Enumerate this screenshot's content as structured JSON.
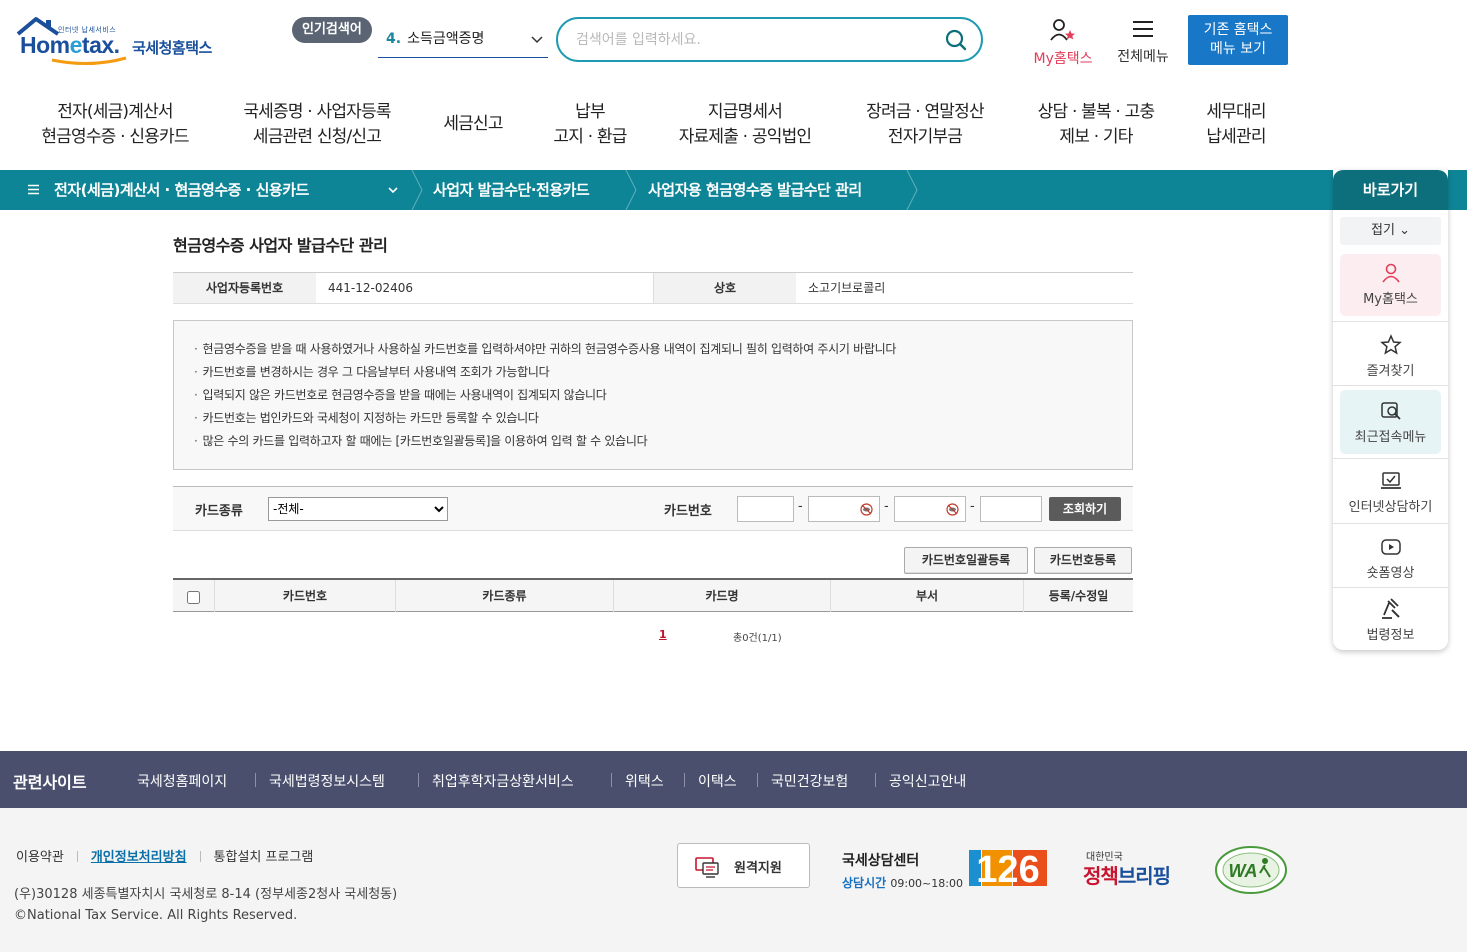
{
  "header": {
    "logo_tagline": "인터넷 납세서비스",
    "logo_word_a": "Hom",
    "logo_word_e": "e",
    "logo_word_b": "tax.",
    "logo_kr": "국세청홈택스",
    "popular_badge": "인기검색어",
    "popular_num": "4.",
    "popular_term": "소득금액증명",
    "search_placeholder": "검색어를 입력하세요.",
    "myhome_label": "My홈택스",
    "allmenu_label": "전체메뉴",
    "oldhome_line1": "기존 홈택스",
    "oldhome_line2": "메뉴 보기"
  },
  "gnb": [
    {
      "l1": "전자(세금)계산서",
      "l2": "현금영수증 · 신용카드"
    },
    {
      "l1": "국세증명 · 사업자등록",
      "l2": "세금관련 신청/신고"
    },
    {
      "l1": "세금신고",
      "l2": ""
    },
    {
      "l1": "납부",
      "l2": "고지 · 환급"
    },
    {
      "l1": "지급명세서",
      "l2": "자료제출 · 공익법인"
    },
    {
      "l1": "장려금 · 연말정산",
      "l2": "전자기부금"
    },
    {
      "l1": "상담 · 불복 · 고충",
      "l2": "제보 · 기타"
    },
    {
      "l1": "세무대리",
      "l2": "납세관리"
    }
  ],
  "breadcrumb": {
    "level1": "전자(세금)계산서 · 현금영수증 · 신용카드",
    "level2": "사업자 발급수단·전용카드",
    "level3": "사업자용 현금영수증 발급수단 관리"
  },
  "quick": {
    "title": "바로가기",
    "fold": "접기",
    "items": [
      "My홈택스",
      "즐겨찾기",
      "최근접속메뉴",
      "인터넷상담하기",
      "숏폼영상",
      "법령정보"
    ]
  },
  "page": {
    "title": "현금영수증 사업자 발급수단 관리",
    "bizno_label": "사업자등록번호",
    "bizno_value": "441-12-02406",
    "company_label": "상호",
    "company_value": "소고기브로콜리",
    "notices": [
      "현금영수증을 받을 때 사용하였거나 사용하실 카드번호를 입력하셔야만 귀하의 현금영수증사용 내역이 집계되니 필히 입력하여 주시기 바랍니다",
      "카드번호를 변경하시는 경우 그 다음날부터 사용내역 조회가 가능합니다",
      "입력되지 않은 카드번호로 현금영수증을 받을 때에는 사용내역이 집계되지 않습니다",
      "카드번호는 법인카드와 국세청이 지정하는 카드만 등록할 수 있습니다",
      "많은 수의 카드를 입력하고자 할 때에는 [카드번호일괄등록]을 이용하여 입력 할 수 있습니다"
    ],
    "filter": {
      "card_type_label": "카드종류",
      "card_type_selected": "-전체-",
      "card_no_label": "카드번호",
      "search_btn": "조회하기"
    },
    "bulk_register_btn": "카드번호일괄등록",
    "register_btn": "카드번호등록",
    "grid_headers": [
      "카드번호",
      "카드종류",
      "카드명",
      "부서",
      "등록/수정일"
    ],
    "pager_current": "1",
    "total_text": "총0건(1/1)"
  },
  "footer": {
    "related_title": "관련사이트",
    "related_links": [
      "국세청홈페이지",
      "국세법령정보시스템",
      "취업후학자금상환서비스",
      "위택스",
      "이택스",
      "국민건강보험",
      "공익신고안내"
    ],
    "terms": "이용약관",
    "privacy": "개인정보처리방침",
    "install": "통합설치 프로그램",
    "address": "(우)30128 세종특별자치시 국세청로 8-14 (정부세종2청사 국세청동)",
    "copyright": "©National Tax Service. All Rights Reserved.",
    "remote_support": "원격지원",
    "call_center": "국세상담센터",
    "call_hours_label": "상담시간",
    "call_hours": "09:00~18:00",
    "call_number": "126",
    "briefing_small": "대한민국",
    "briefing_a": "정책",
    "briefing_b": "브리핑",
    "wa_mark": "WA"
  },
  "colors": {
    "teal": "#0e8596",
    "brand_blue": "#1a4f9c",
    "footer_bar": "#4a4f6d",
    "accent_pink": "#e23d59"
  }
}
